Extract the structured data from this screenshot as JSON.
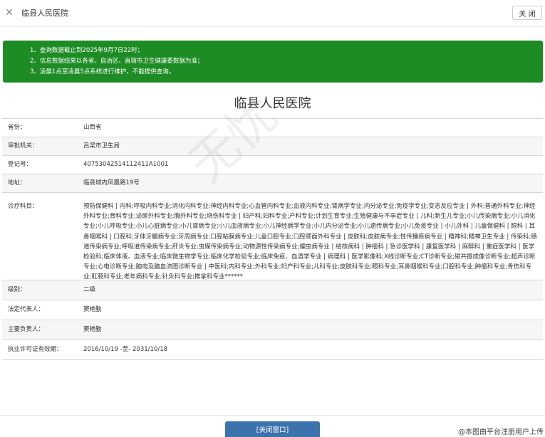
{
  "header": {
    "title": "临县人民医院",
    "close_button": "关 闭"
  },
  "notice": [
    "1、查询数据截止到2025年9月7日22时；",
    "2、信息数据结果以各省、自治区、直辖市卫生健康委数据为准；",
    "3、凌晨1点至凌晨5点系统进行维护，不能提供查询。"
  ],
  "page": {
    "title": "临县人民医院"
  },
  "info": {
    "province_label": "省份：",
    "province_value": "山西省",
    "authority_label": "审批机关：",
    "authority_value": "吕梁市卫生局",
    "reg_label": "登记号：",
    "reg_value": "40753042514112411A1001",
    "address_label": "地址：",
    "address_value": "临县城内凤凰路19号",
    "subjects_label": "诊疗科目：",
    "subjects_value": "预防保健科 | 内科;呼吸内科专业;消化内科专业;神经内科专业;心血管内科专业;血液内科专业;肾病学专业;内分泌专业;免疫学专业;变态反应专业 | 外科;普通外科专业;神经外科专业;骨科专业;泌尿外科专业;胸外科专业;烧伤科专业 | 妇产科;妇科专业;产科专业;计划生育专业;生殖健康与不孕症专业 | 儿科;新生儿专业;小儿传染病专业;小儿消化专业;小儿呼吸专业;小儿心脏病专业;小儿肾病专业;小儿血液病专业;小儿神经病学专业;小儿内分泌专业;小儿遗传病专业;小儿免疫专业 | 小儿外科 | 儿童保健科 | 眼科 | 耳鼻咽喉科 | 口腔科;牙体牙髓病专业;牙周病专业;口腔粘膜病专业;儿童口腔专业;口腔颌面外科专业 | 皮肤科;皮肤病专业;性传播疾病专业 | 精神科;精神卫生专业 | 传染科;肠道传染病专业;呼吸道传染病专业;肝炎专业;虫媒传染病专业;动物源性传染病专业;蠕虫病专业 | 结核病科 | 肿瘤科 | 急诊医学科 | 康复医学科 | 麻醉科 | 重症医学科 | 医学检验科;临床体液、血液专业;临床微生物学专业;临床化学检验专业;临床免疫、血清学专业 | 病理科 | 医学影像科;X线诊断专业;CT诊断专业;磁共振成像诊断专业;超声诊断专业;心电诊断专业;脑电及脑血流图诊断专业 | 中医科;内科专业;外科专业;妇产科专业;儿科专业;皮肤科专业;眼科专业;耳鼻咽喉科专业;口腔科专业;肿瘤科专业;骨伤科专业;肛肠科专业;老年病科专业;针灸科专业;推拿科专业******",
    "level_label": "级别：",
    "level_value": "二级",
    "legal_label": "法定代表人：",
    "legal_value": "窦艳勤",
    "principal_label": "主要负责人：",
    "principal_value": "窦艳勤",
    "validity_label": "执业许可证有效期：",
    "validity_value": "2016/10/19 -至- 2031/10/18"
  },
  "footer": {
    "close_window_button": "[关闭窗口]",
    "credit": "@本图由平台注册用户上传"
  },
  "colors": {
    "notice_bg": "#1e8c25",
    "button_blue": "#3d73ad"
  }
}
